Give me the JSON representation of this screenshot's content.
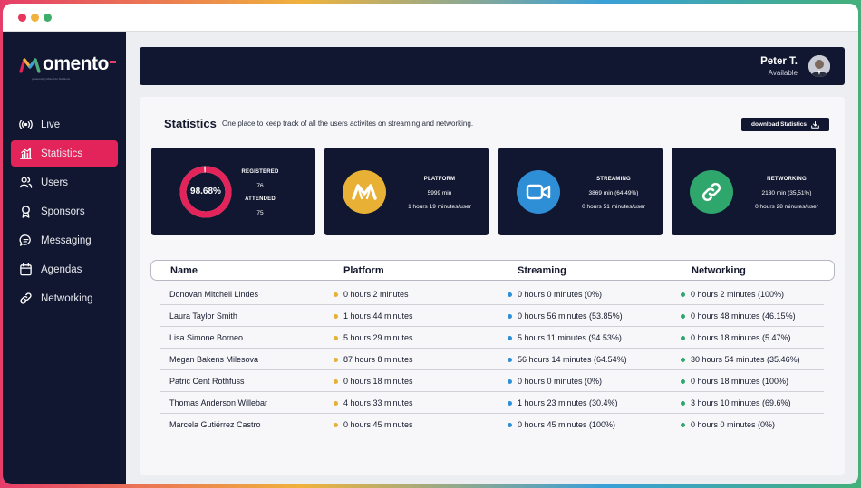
{
  "colors": {
    "accent": "#e2245a",
    "navy": "#111731",
    "platform": "#e8b034",
    "streaming": "#2f8fd6",
    "networking": "#2fa66b",
    "gauge_track": "#e2245a",
    "gauge_fill": "#f4c1cf"
  },
  "brand": {
    "name": "omento",
    "tagline": "powered by Momento Solutions"
  },
  "sidebar": {
    "items": [
      {
        "label": "Live",
        "icon": "broadcast-icon"
      },
      {
        "label": "Statistics",
        "icon": "bar-chart-icon",
        "active": true
      },
      {
        "label": "Users",
        "icon": "users-icon"
      },
      {
        "label": "Sponsors",
        "icon": "award-icon"
      },
      {
        "label": "Messaging",
        "icon": "chat-icon"
      },
      {
        "label": "Agendas",
        "icon": "calendar-icon"
      },
      {
        "label": "Networking",
        "icon": "link-icon"
      }
    ]
  },
  "header": {
    "user_name": "Peter T.",
    "user_status": "Available"
  },
  "statistics": {
    "title": "Statistics",
    "subtitle": "One place to keep track of all the users activites on streaming and networking.",
    "download_label": "download Statistics"
  },
  "cards": {
    "attendance": {
      "percent_label": "98.68%",
      "percent_value": 98.68,
      "registered_label": "REGISTERED",
      "registered": "76",
      "attended_label": "ATTENDED",
      "attended": "75"
    },
    "platform": {
      "title": "PLATFORM",
      "total": "5999 min",
      "per_user": "1 hours 19 minutes/user",
      "icon": "momento-logo-icon"
    },
    "streaming": {
      "title": "STREAMING",
      "total": "3869 min (64.49%)",
      "per_user": "0 hours 51 minutes/user",
      "icon": "video-camera-icon"
    },
    "networking": {
      "title": "NETWORKING",
      "total": "2130 min (35,51%)",
      "per_user": "0 hours 28 minutes/user",
      "icon": "link-icon"
    }
  },
  "table": {
    "columns": [
      "Name",
      "Platform",
      "Streaming",
      "Networking"
    ],
    "rows": [
      {
        "name": "Donovan Mitchell Lindes",
        "platform": "0 hours 2 minutes",
        "streaming": "0 hours 0 minutes (0%)",
        "networking": "0 hours 2 minutes (100%)"
      },
      {
        "name": "Laura Taylor Smith",
        "platform": "1 hours 44 minutes",
        "streaming": "0 hours 56 minutes (53.85%)",
        "networking": "0 hours 48 minutes (46.15%)"
      },
      {
        "name": "Lisa Simone Borneo",
        "platform": "5 hours 29 minutes",
        "streaming": "5 hours 11 minutes (94.53%)",
        "networking": "0 hours 18 minutes (5.47%)"
      },
      {
        "name": "Megan Bakens Milesova",
        "platform": "87 hours 8 minutes",
        "streaming": "56 hours 14 minutes (64.54%)",
        "networking": "30 hours 54 minutes (35.46%)"
      },
      {
        "name": "Patric Cent Rothfuss",
        "platform": "0 hours 18 minutes",
        "streaming": "0 hours 0 minutes (0%)",
        "networking": "0 hours 18 minutes (100%)"
      },
      {
        "name": "Thomas Anderson Willebar",
        "platform": "4 hours 33 minutes",
        "streaming": "1 hours 23 minutes (30.4%)",
        "networking": "3 hours 10 minutes (69.6%)"
      },
      {
        "name": "Marcela Gutiérrez Castro",
        "platform": "0 hours 45 minutes",
        "streaming": "0 hours 45 minutes (100%)",
        "networking": "0 hours 0 minutes (0%)"
      }
    ]
  }
}
